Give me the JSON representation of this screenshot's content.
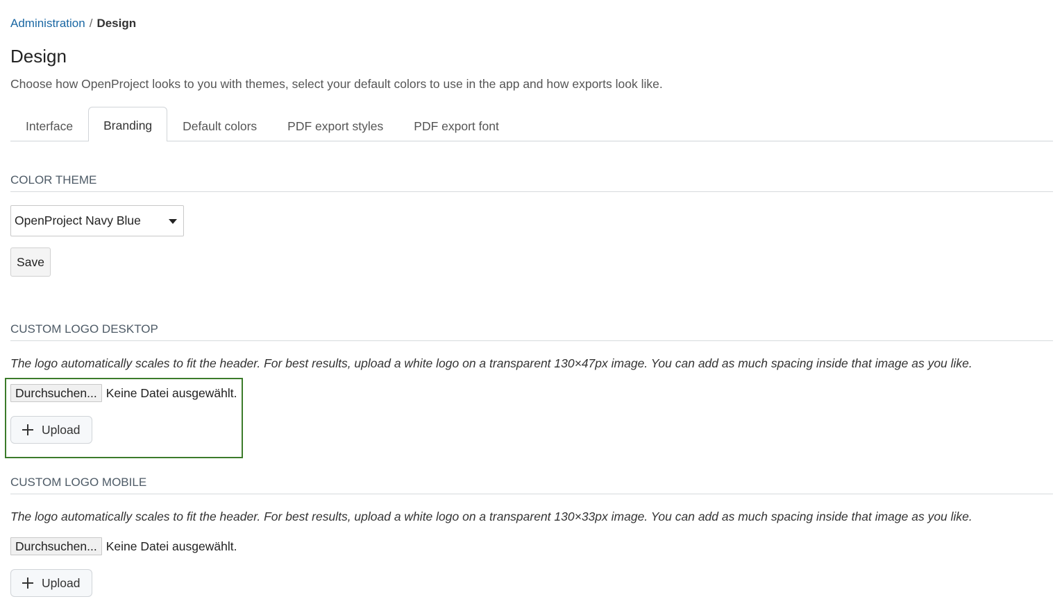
{
  "breadcrumb": {
    "parent": "Administration",
    "separator": "/",
    "current": "Design"
  },
  "page": {
    "title": "Design",
    "description": "Choose how OpenProject looks to you with themes, select your default colors to use in the app and how exports look like."
  },
  "tabs": [
    {
      "label": "Interface",
      "active": false
    },
    {
      "label": "Branding",
      "active": true
    },
    {
      "label": "Default colors",
      "active": false
    },
    {
      "label": "PDF export styles",
      "active": false
    },
    {
      "label": "PDF export font",
      "active": false
    }
  ],
  "color_theme": {
    "heading": "COLOR THEME",
    "selected": "OpenProject Navy Blue",
    "save_label": "Save"
  },
  "logo_desktop": {
    "heading": "CUSTOM LOGO DESKTOP",
    "hint": "The logo automatically scales to fit the header. For best results, upload a white logo on a transparent 130×47px image. You can add as much spacing inside that image as you like.",
    "browse_label": "Durchsuchen...",
    "no_file_label": "Keine Datei ausgewählt.",
    "upload_label": "Upload"
  },
  "logo_mobile": {
    "heading": "CUSTOM LOGO MOBILE",
    "hint": "The logo automatically scales to fit the header. For best results, upload a white logo on a transparent 130×33px image. You can add as much spacing inside that image as you like.",
    "browse_label": "Durchsuchen...",
    "no_file_label": "Keine Datei ausgewählt.",
    "upload_label": "Upload"
  },
  "colors": {
    "link": "#1a67a3",
    "highlight_frame": "#3b7b2a",
    "heading": "#4d5a66"
  },
  "icons": {
    "select_caret": "caret-down-icon",
    "upload": "plus-icon"
  }
}
